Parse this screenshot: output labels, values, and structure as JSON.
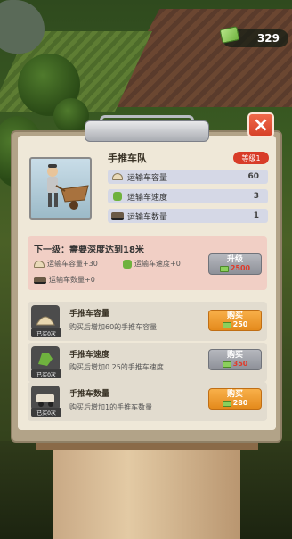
{
  "hud": {
    "money": "329"
  },
  "dialog": {
    "title": "手推车队",
    "level_badge": "等级1",
    "close_symbol": "×",
    "stats": [
      {
        "icon": "cargo-icon",
        "label": "运输车容量",
        "value": "60"
      },
      {
        "icon": "speed-icon",
        "label": "运输车速度",
        "value": "3"
      },
      {
        "icon": "cart-icon",
        "label": "运输车数量",
        "value": "1"
      }
    ],
    "next_level": {
      "title": "下一级：需要深度达到18米",
      "bonuses": {
        "capacity": "运输车容量+30",
        "speed": "运输车速度+0",
        "count": "运输车数量+0"
      },
      "button_label": "升级",
      "price": "2500",
      "price_color": "#e03a2a"
    },
    "items": [
      {
        "title": "手推车容量",
        "desc": "购买后增加60的手推车容量",
        "bought": "已买0次",
        "button_label": "购买",
        "price": "250",
        "button_style": "orange"
      },
      {
        "title": "手推车速度",
        "desc": "购买后增加0.25的手推车速度",
        "bought": "已买0次",
        "button_label": "购买",
        "price": "350",
        "button_style": "grey"
      },
      {
        "title": "手推车数量",
        "desc": "购买后增加1的手推车数量",
        "bought": "已买0次",
        "button_label": "购买",
        "price": "280",
        "button_style": "orange"
      }
    ]
  }
}
